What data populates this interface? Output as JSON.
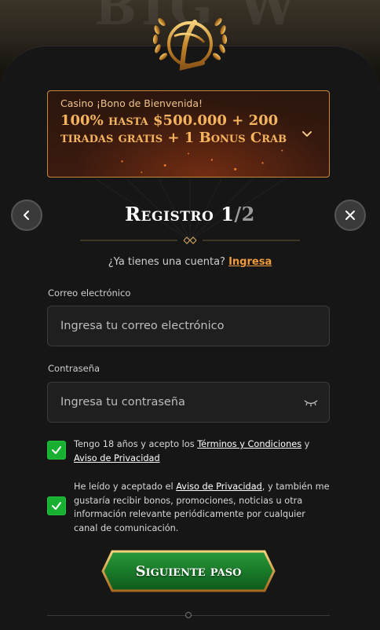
{
  "bonus": {
    "label": "Casino ¡Bono de Bienvenida!",
    "title": "100% hasta $500.000 + 200 tiradas gratis + 1 Bonus Crab"
  },
  "header": {
    "title": "Registro 1",
    "step_suffix": "/2"
  },
  "login_prompt": {
    "text": "¿Ya tienes una cuenta?",
    "link": "Ingresa"
  },
  "form": {
    "email_label": "Correo electrónico",
    "email_placeholder": "Ingresa tu correo electrónico",
    "password_label": "Contraseña",
    "password_placeholder": "Ingresa tu contraseña"
  },
  "consents": [
    {
      "checked": true,
      "text_before": "Tengo 18 años y acepto los ",
      "link1": "Términos y Condiciones",
      "text_mid": " y ",
      "link2": "Aviso de Privacidad"
    },
    {
      "checked": true,
      "text_before": "He leído y aceptado el ",
      "link1": "Aviso de Privacidad",
      "text_after": ", y también me gustaría recibir bonos, promociones, noticias u otra información relevante periódicamente por cualquier canal de comunicación."
    }
  ],
  "cta": {
    "label": "Siguiente paso"
  },
  "icons": {
    "back": "chevron-left-icon",
    "close": "close-icon",
    "expand": "chevron-down-icon",
    "password_toggle": "eye-closed-icon",
    "check": "checkmark-icon",
    "logo": "laurel-logo-icon"
  },
  "colors": {
    "accent": "#f09a3c",
    "gold": "#f4b35c",
    "check_green": "#18b030",
    "cta_green": "#1a7a2a"
  }
}
